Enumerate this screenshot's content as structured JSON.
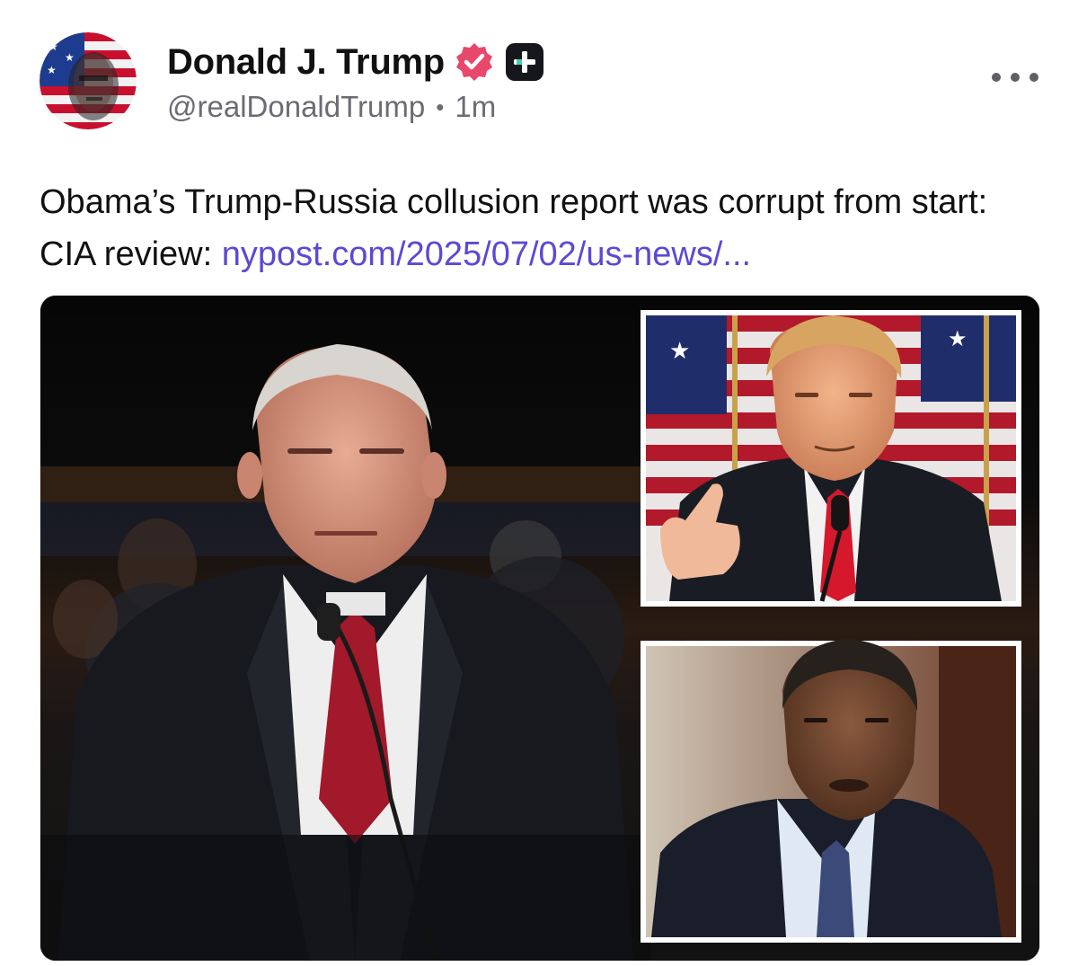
{
  "post": {
    "author": {
      "display_name": "Donald J. Trump",
      "handle": "@realDonaldTrump",
      "time_ago": "1m",
      "separator": "•",
      "avatar_icon": "avatar-flag-face",
      "verified_icon": "verified-badge-icon",
      "verified_color": "#e8486b",
      "plus_icon": "plus-badge-icon"
    },
    "text_before_link": "Obama’s Trump-Russia collusion report was corrupt from start: CIA review: ",
    "link_text": "nypost.com/2025/07/02/us-news/...",
    "link_color": "#5b49d6",
    "media": {
      "type": "photo-collage",
      "panels": [
        "main-photo-man-at-hearing",
        "inset-photo-thumbs-up-flags",
        "inset-photo-man-speaking"
      ]
    },
    "more_icon": "more-horizontal-icon"
  }
}
